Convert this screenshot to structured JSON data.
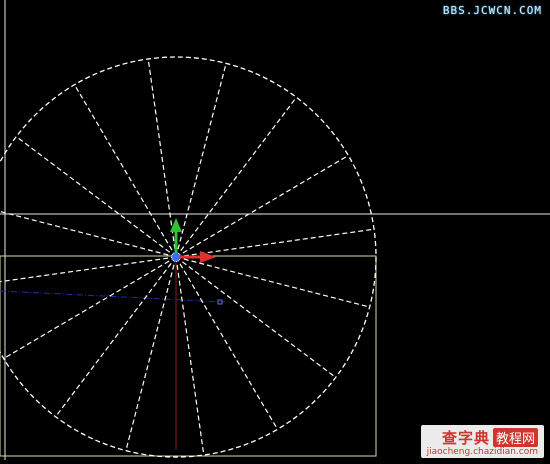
{
  "canvas": {
    "background": "#000000",
    "linework_color": "#ffffff",
    "guide_line_color": "#d8d8a0",
    "ucs_x_color": "#e03030",
    "ucs_y_color": "#30c030",
    "ucs_origin_color": "#3070ff",
    "objects": [
      "dashed-circle",
      "radial-spokes",
      "crosshair",
      "ucs-gizmo",
      "rectangle-outline"
    ]
  },
  "watermarks": {
    "top": "BBS.JCWCN.COM",
    "bottom_cn": "查字典",
    "bottom_cn_sub": "教程网",
    "bottom_url": "jiaocheng.chazidian.com"
  }
}
